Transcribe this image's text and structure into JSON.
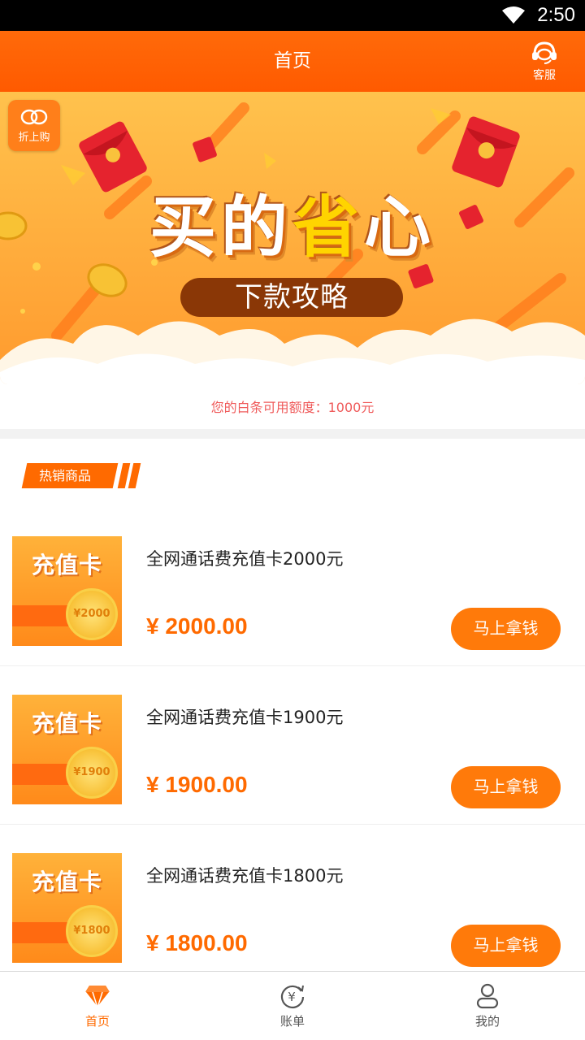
{
  "status_bar": {
    "time": "2:50"
  },
  "app_bar": {
    "title": "首页",
    "service_label": "客服"
  },
  "banner": {
    "logo_text": "折上购",
    "headline_part1": "买的",
    "headline_highlight": "省",
    "headline_part2": "心",
    "button_text": "下款攻略"
  },
  "credit": {
    "text": "您的白条可用额度：1000元"
  },
  "section": {
    "title": "热销商品"
  },
  "products": [
    {
      "thumb_title": "充值卡",
      "coin_text": "¥2000",
      "name": "全网通话费充值卡2000元",
      "price": "¥ 2000.00",
      "button": "马上拿钱"
    },
    {
      "thumb_title": "充值卡",
      "coin_text": "¥1900",
      "name": "全网通话费充值卡1900元",
      "price": "¥ 1900.00",
      "button": "马上拿钱"
    },
    {
      "thumb_title": "充值卡",
      "coin_text": "¥1800",
      "name": "全网通话费充值卡1800元",
      "price": "¥ 1800.00",
      "button": "马上拿钱"
    }
  ],
  "bottom_nav": [
    {
      "label": "首页",
      "icon": "diamond-icon",
      "active": true
    },
    {
      "label": "账单",
      "icon": "bill-yen-icon",
      "active": false
    },
    {
      "label": "我的",
      "icon": "user-icon",
      "active": false
    }
  ],
  "colors": {
    "primary": "#ff6a00",
    "credit_text": "#ef5a5a",
    "banner_pill": "#8a3706"
  }
}
